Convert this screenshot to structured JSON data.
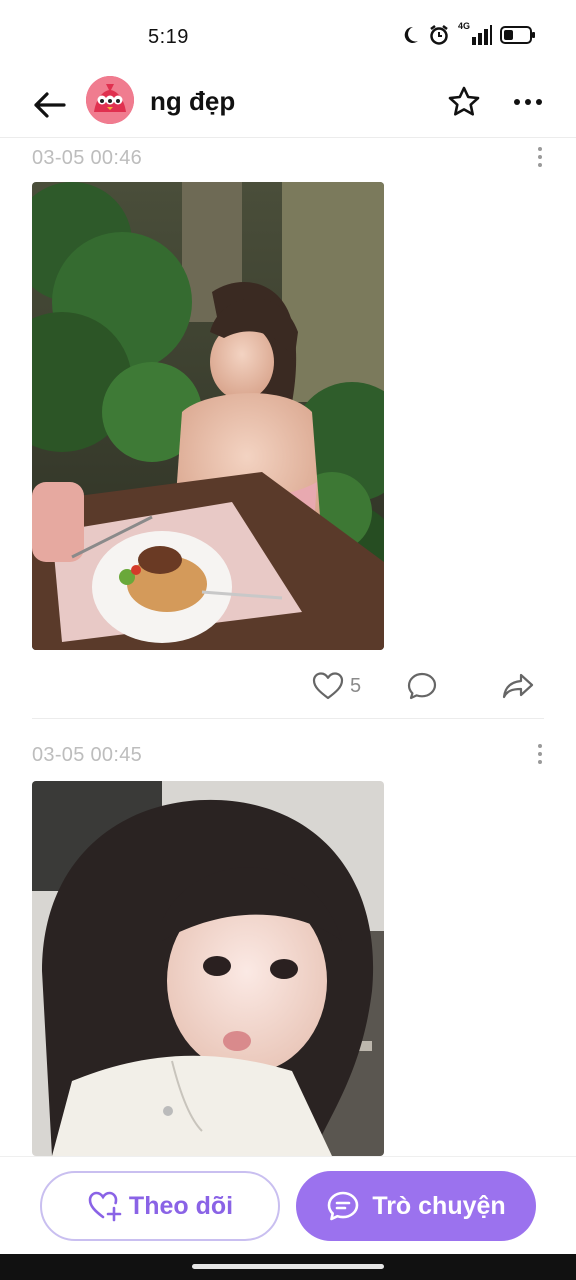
{
  "status_bar": {
    "time": "5:19",
    "network": "4G",
    "icons": [
      "moon-icon",
      "alarm-icon",
      "signal-icon",
      "battery-icon"
    ]
  },
  "header": {
    "title": "ng đẹp",
    "back_icon": "arrow-left-icon",
    "star_icon": "star-icon",
    "more_icon": "more-icon"
  },
  "posts": [
    {
      "time": "03-05 00:46",
      "likes": "5",
      "image": "photo of woman dining with pasta and steak"
    },
    {
      "time": "03-05 00:45",
      "likes": "",
      "image": "selfie photo of woman with long dark hair"
    }
  ],
  "bottom": {
    "follow_label": "Theo dõi",
    "chat_label": "Trò chuyện"
  },
  "colors": {
    "accent": "#9b72ee",
    "accent_light": "#c9bff0",
    "timestamp": "#bdbdbd",
    "avatar": "#e84a6e"
  }
}
